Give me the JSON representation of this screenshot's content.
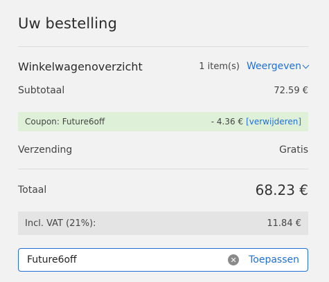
{
  "order": {
    "title": "Uw bestelling",
    "cart_overview_label": "Winkelwagenoverzicht",
    "items_count": "1 item(s)",
    "view_label": "Weergeven",
    "subtotal_label": "Subtotaal",
    "subtotal_value": "72.59 €",
    "coupon_label": "Coupon: Future6off",
    "coupon_discount": "- 4.36 €",
    "coupon_remove_label": "[verwijderen]",
    "shipping_label": "Verzending",
    "shipping_value": "Gratis",
    "total_label": "Totaal",
    "total_value": "68.23 €",
    "vat_label": "Incl. VAT (21%):",
    "vat_value": "11.84 €",
    "coupon_input_value": "Future6off",
    "apply_label": "Toepassen"
  },
  "colors": {
    "accent": "#1f6fd6",
    "coupon_bg": "#dff0d8",
    "vat_bg": "#e4e4e4",
    "panel_bg": "#f2f2f2"
  },
  "icons": {
    "view_chevron": "chevron-down-icon",
    "clear_input": "clear-icon"
  }
}
